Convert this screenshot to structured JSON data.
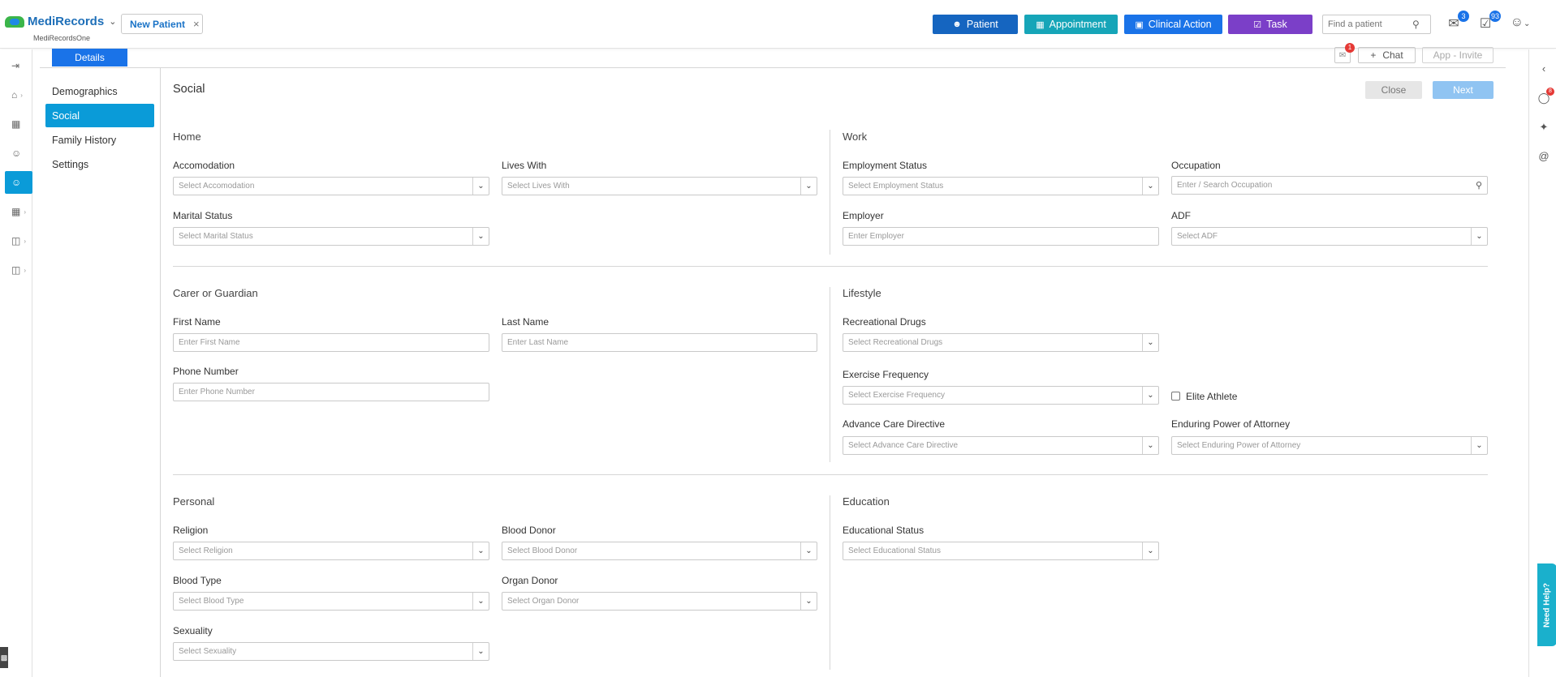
{
  "app": {
    "name": "MediRecords",
    "subname": "MediRecordsOne"
  },
  "top_tab": {
    "label": "New Patient"
  },
  "quick_actions": {
    "patient": "Patient",
    "appointment": "Appointment",
    "clinical_action": "Clinical Action",
    "task": "Task"
  },
  "search": {
    "placeholder": "Find a patient"
  },
  "badges": {
    "mail": "3",
    "tasks": "93",
    "frame_mail": "1",
    "right_chat": "8"
  },
  "details_tab": "Details",
  "frame_buttons": {
    "chat": "Chat",
    "invite": "App - Invite"
  },
  "side_nav": [
    "Demographics",
    "Social",
    "Family History",
    "Settings"
  ],
  "side_nav_active": "Social",
  "page": {
    "title": "Social",
    "close": "Close",
    "next": "Next"
  },
  "sections": {
    "home": "Home",
    "work": "Work",
    "carer": "Carer or Guardian",
    "lifestyle": "Lifestyle",
    "personal": "Personal",
    "education": "Education"
  },
  "fields": {
    "accomodation": {
      "label": "Accomodation",
      "placeholder": "Select Accomodation"
    },
    "lives_with": {
      "label": "Lives With",
      "placeholder": "Select Lives With"
    },
    "marital_status": {
      "label": "Marital Status",
      "placeholder": "Select Marital Status"
    },
    "employment_status": {
      "label": "Employment Status",
      "placeholder": "Select Employment Status"
    },
    "occupation": {
      "label": "Occupation",
      "placeholder": "Enter / Search Occupation"
    },
    "employer": {
      "label": "Employer",
      "placeholder": "Enter Employer"
    },
    "adf": {
      "label": "ADF",
      "placeholder": "Select ADF"
    },
    "first_name": {
      "label": "First Name",
      "placeholder": "Enter First Name"
    },
    "last_name": {
      "label": "Last Name",
      "placeholder": "Enter Last Name"
    },
    "phone_number": {
      "label": "Phone Number",
      "placeholder": "Enter Phone Number"
    },
    "recreational_drugs": {
      "label": "Recreational Drugs",
      "placeholder": "Select Recreational Drugs"
    },
    "exercise_frequency": {
      "label": "Exercise Frequency",
      "placeholder": "Select Exercise Frequency"
    },
    "elite_athlete": {
      "label": "Elite Athlete",
      "checked": false
    },
    "advance_care_directive": {
      "label": "Advance Care Directive",
      "placeholder": "Select Advance Care Directive"
    },
    "enduring_power": {
      "label": "Enduring Power of Attorney",
      "placeholder": "Select Enduring Power of Attorney"
    },
    "religion": {
      "label": "Religion",
      "placeholder": "Select Religion"
    },
    "blood_donor": {
      "label": "Blood Donor",
      "placeholder": "Select Blood Donor"
    },
    "blood_type": {
      "label": "Blood Type",
      "placeholder": "Select Blood Type"
    },
    "organ_donor": {
      "label": "Organ Donor",
      "placeholder": "Select Organ Donor"
    },
    "sexuality": {
      "label": "Sexuality",
      "placeholder": "Select Sexuality"
    },
    "educational_status": {
      "label": "Educational Status",
      "placeholder": "Select Educational Status"
    }
  },
  "help": {
    "label": "Need Help?"
  },
  "colors": {
    "primary": "#1a73e8",
    "active_nav": "#0a9bd8",
    "appointment": "#16a5b8",
    "task": "#7b3fc8",
    "patient": "#1565c0"
  }
}
